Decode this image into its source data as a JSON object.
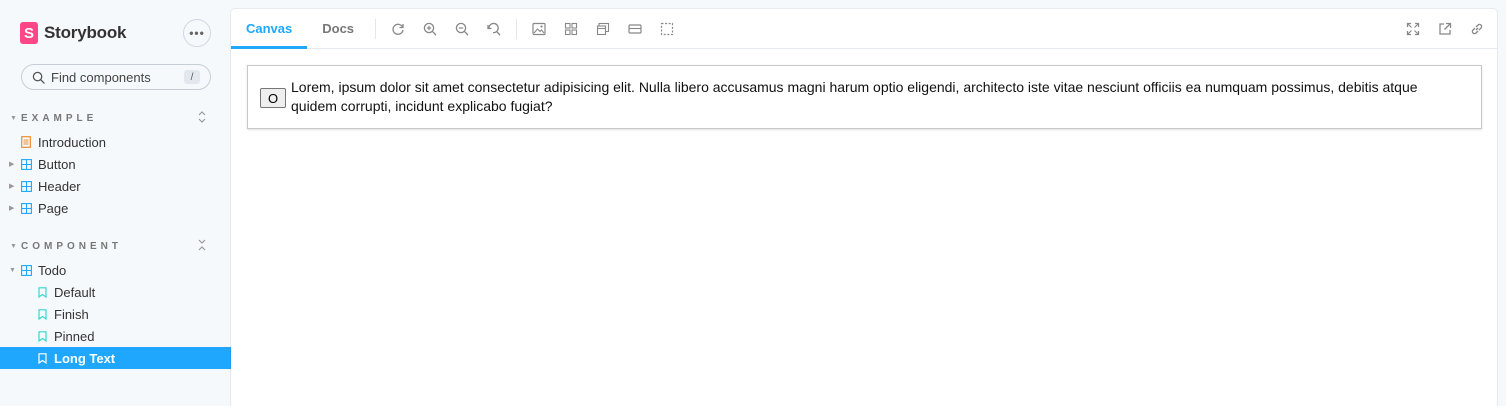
{
  "brand": {
    "name": "Storybook",
    "logo_letter": "S",
    "accent": "#ff4785"
  },
  "sidebar": {
    "menu_label": "•••",
    "search": {
      "placeholder": "Find components",
      "shortcut": "/"
    },
    "groups": [
      {
        "label": "EXAMPLE",
        "items": [
          {
            "label": "Introduction",
            "icon": "document-icon"
          },
          {
            "label": "Button",
            "icon": "component-icon"
          },
          {
            "label": "Header",
            "icon": "component-icon"
          },
          {
            "label": "Page",
            "icon": "component-icon"
          }
        ]
      },
      {
        "label": "COMPONENT",
        "items": [
          {
            "label": "Todo",
            "icon": "component-icon"
          },
          {
            "label": "Default",
            "icon": "bookmark-icon"
          },
          {
            "label": "Finish",
            "icon": "bookmark-icon"
          },
          {
            "label": "Pinned",
            "icon": "bookmark-icon"
          },
          {
            "label": "Long Text",
            "icon": "bookmark-icon",
            "selected": true
          }
        ]
      }
    ],
    "selected_color": "#1ea7fd"
  },
  "toolbar": {
    "tabs": [
      {
        "label": "Canvas",
        "active": true
      },
      {
        "label": "Docs",
        "active": false
      }
    ]
  },
  "preview": {
    "button_label": "O",
    "text": "Lorem, ipsum dolor sit amet consectetur adipisicing elit. Nulla libero accusamus magni harum optio eligendi, architecto iste vitae nesciunt officiis ea numquam possimus, debitis atque quidem corrupti, incidunt explicabo fugiat?"
  }
}
